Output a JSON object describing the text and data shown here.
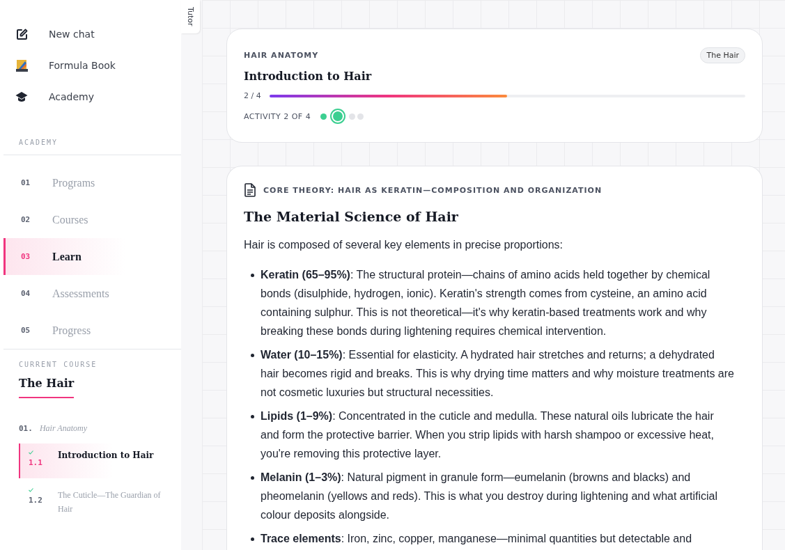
{
  "sidebar": {
    "top_items": [
      {
        "label": "New chat"
      },
      {
        "label": "Formula Book"
      },
      {
        "label": "Academy"
      }
    ],
    "section_label": "ACADEMY",
    "nav": [
      {
        "number": "01",
        "label": "Programs",
        "selected": false
      },
      {
        "number": "02",
        "label": "Courses",
        "selected": false
      },
      {
        "number": "03",
        "label": "Learn",
        "selected": true
      },
      {
        "number": "04",
        "label": "Assessments",
        "selected": false
      },
      {
        "number": "05",
        "label": "Progress",
        "selected": false
      }
    ],
    "current_course": {
      "label": "CURRENT COURSE",
      "title": "The Hair",
      "modules": [
        {
          "number": "01.",
          "title": "Hair Anatomy",
          "lessons": [
            {
              "number": "1.1",
              "title": "Introduction to Hair",
              "done": true,
              "selected": true
            },
            {
              "number": "1.2",
              "title": "The Cuticle—The Guardian of Hair",
              "done": true,
              "selected": false
            }
          ]
        }
      ]
    }
  },
  "tutor_tab": {
    "label": "Tutor"
  },
  "lesson_card": {
    "module": "HAIR ANATOMY",
    "badge": "The Hair",
    "title": "Introduction to Hair",
    "progress_text": "2 / 4",
    "level": 0.5,
    "activity_text": "ACTIVITY 2 OF 4",
    "steps": [
      {
        "completed": true,
        "selected": false
      },
      {
        "completed": true,
        "selected": true
      },
      {
        "completed": false,
        "selected": false
      },
      {
        "completed": false,
        "selected": false
      }
    ]
  },
  "content_card": {
    "section": "CORE THEORY: HAIR AS KERATIN—COMPOSITION AND ORGANIZATION",
    "heading": "The Material Science of Hair",
    "intro": "Hair is composed of several key elements in precise proportions:",
    "bullets": [
      "**Keratin (65–95%)**: The structural protein—chains of amino acids held together by chemical bonds (disulphide, hydrogen, ionic). Keratin's strength comes from cysteine, an amino acid containing sulphur. This is not theoretical—it's why keratin-based treatments work and why breaking these bonds during lightening requires chemical intervention.",
      "**Water (10–15%)**: Essential for elasticity. A hydrated hair stretches and returns; a dehydrated hair becomes rigid and breaks. This is why drying time matters and why moisture treatments are not cosmetic luxuries but structural necessities.",
      "**Lipids (1–9%)**: Concentrated in the cuticle and medulla. These natural oils lubricate the hair and form the protective barrier. When you strip lipids with harsh shampoo or excessive heat, you're removing this protective layer.",
      "**Melanin (1–3%)**: Natural pigment in granule form—eumelanin (browns and blacks) and pheomelanin (yellows and reds). This is what you destroy during lightening and what artificial colour deposits alongside.",
      "**Trace elements**: Iron, zinc, copper, manganese—minimal quantities but detectable and"
    ]
  }
}
